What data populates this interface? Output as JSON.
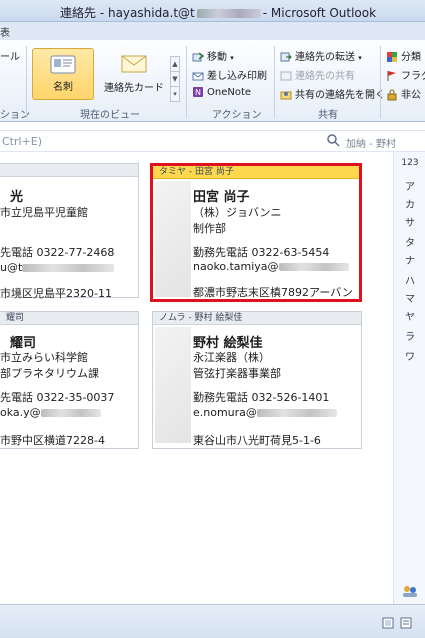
{
  "window": {
    "title_left": "連絡先 - hayashida.t@t",
    "title_right": "- Microsoft Outlook"
  },
  "ribbon": {
    "tab_fragment": "表",
    "left_fragment_1": "ール",
    "left_group_fragment": "ション",
    "current_view": {
      "card_label": "名刺",
      "business_card_label": "連絡先カード",
      "group_label": "現在のビュー"
    },
    "actions": {
      "move": "移動",
      "mail_merge": "差し込み印刷",
      "onenote": "OneNote",
      "group_label": "アクション"
    },
    "share": {
      "forward": "連絡先の転送",
      "share_contacts": "連絡先の共有",
      "open_shared": "共有の連絡先を開く",
      "group_label": "共有"
    },
    "tags": {
      "categorize": "分類",
      "follow_up": "フラグ",
      "private": "非公"
    }
  },
  "search": {
    "placeholder": "Ctrl+E)",
    "address_book_label": "加納 - 野村"
  },
  "index": [
    "123",
    "ア",
    "カ",
    "サ",
    "タ",
    "ナ",
    "ハ",
    "マ",
    "ヤ",
    "ラ",
    "ワ"
  ],
  "cards": [
    {
      "header": "",
      "name": "光",
      "lines": [
        "市立児島平児童館"
      ],
      "phone": "先電話 0322-77-2468",
      "email": "u@t",
      "address": "市境区児島平2320-11"
    },
    {
      "header": "タミヤ - 田宮 尚子",
      "name": "田宮 尚子",
      "lines": [
        "（株）ジョバンニ",
        "制作部"
      ],
      "phone": "勤務先電話 0322-63-5454",
      "email": "naoko.tamiya@",
      "address": "都濃市野志末区槙7892アーバン"
    },
    {
      "header": "耀司",
      "name": "耀司",
      "lines": [
        "市立みらい科学館",
        "部プラネタリウム課"
      ],
      "phone": "先電話 0322-35-0037",
      "email": "oka.y@",
      "address": "市野中区横道7228-4"
    },
    {
      "header": "ノムラ - 野村 絵梨佳",
      "name": "野村 絵梨佳",
      "lines": [
        "永江楽器（株）",
        "管弦打楽器事業部"
      ],
      "phone": "勤務先電話 032-526-1401",
      "email": "e.nomura@",
      "address": "東谷山市八光町荷見5-1-6"
    }
  ],
  "colors": {
    "selected_border": "#e01020",
    "selected_header": "#fdd84e",
    "ribbon_active": "#ffd46b"
  }
}
